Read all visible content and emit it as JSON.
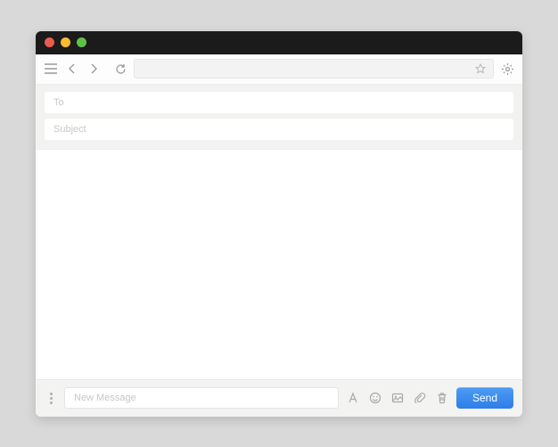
{
  "titlebar": {
    "close": "close",
    "minimize": "minimize",
    "maximize": "maximize"
  },
  "toolbar": {
    "menu": "menu",
    "back": "back",
    "forward": "forward",
    "reload": "reload",
    "address_value": "",
    "bookmark": "bookmark",
    "settings": "settings"
  },
  "compose": {
    "to_placeholder": "To",
    "to_value": "",
    "subject_placeholder": "Subject",
    "subject_value": "",
    "body_value": ""
  },
  "footer": {
    "more": "more",
    "new_message_placeholder": "New Message",
    "new_message_value": "",
    "icons": {
      "format": "text-format",
      "emoji": "emoji",
      "image": "image",
      "attach": "attach",
      "delete": "delete"
    },
    "send_label": "Send"
  },
  "colors": {
    "accent": "#2f7de8",
    "bg": "#d9d9d9"
  }
}
